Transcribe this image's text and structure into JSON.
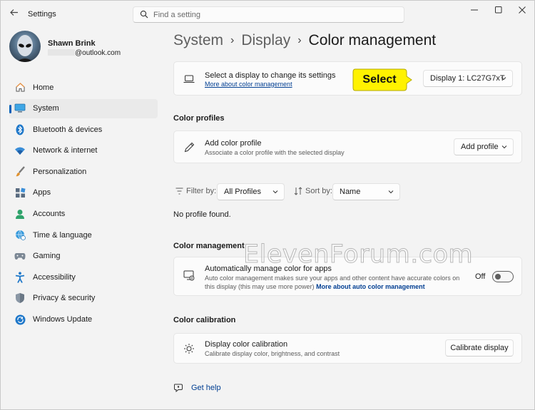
{
  "window": {
    "app_title": "Settings",
    "back_icon": "back-arrow-icon",
    "controls": [
      "minimize-icon",
      "maximize-icon",
      "close-icon"
    ]
  },
  "search": {
    "placeholder": "Find a setting"
  },
  "profile": {
    "name": "Shawn Brink",
    "email_suffix": "@outlook.com"
  },
  "sidebar": {
    "items": [
      {
        "label": "Home",
        "icon": "home-icon",
        "active": false
      },
      {
        "label": "System",
        "icon": "system-icon",
        "active": true
      },
      {
        "label": "Bluetooth & devices",
        "icon": "bluetooth-icon",
        "active": false
      },
      {
        "label": "Network & internet",
        "icon": "wifi-icon",
        "active": false
      },
      {
        "label": "Personalization",
        "icon": "brush-icon",
        "active": false
      },
      {
        "label": "Apps",
        "icon": "apps-icon",
        "active": false
      },
      {
        "label": "Accounts",
        "icon": "account-icon",
        "active": false
      },
      {
        "label": "Time & language",
        "icon": "globe-clock-icon",
        "active": false
      },
      {
        "label": "Gaming",
        "icon": "gamepad-icon",
        "active": false
      },
      {
        "label": "Accessibility",
        "icon": "accessibility-icon",
        "active": false
      },
      {
        "label": "Privacy & security",
        "icon": "shield-icon",
        "active": false
      },
      {
        "label": "Windows Update",
        "icon": "update-icon",
        "active": false
      }
    ]
  },
  "breadcrumb": {
    "level1": "System",
    "level2": "Display",
    "current": "Color management",
    "separator": "›"
  },
  "display_card": {
    "title": "Select a display to change its settings",
    "link": "More about color management",
    "dropdown_value": "Display 1: LC27G7xT",
    "callout": "Select"
  },
  "color_profiles": {
    "heading": "Color profiles",
    "add_title": "Add color profile",
    "add_sub": "Associate a color profile with the selected display",
    "add_button": "Add profile",
    "filter_label": "Filter by:",
    "filter_value": "All Profiles",
    "sort_label": "Sort by:",
    "sort_value": "Name",
    "empty_text": "No profile found."
  },
  "color_management": {
    "heading": "Color management",
    "auto_title": "Automatically manage color for apps",
    "auto_sub_1": "Auto color management makes sure your apps and other content have accurate colors on",
    "auto_sub_2": "this display (this may use more power)",
    "auto_link": "More about auto color management",
    "toggle_state": "Off"
  },
  "color_calibration": {
    "heading": "Color calibration",
    "title": "Display color calibration",
    "sub": "Calibrate display color, brightness, and contrast",
    "button": "Calibrate display"
  },
  "help": {
    "label": "Get help"
  },
  "watermark": "ElevenForum.com",
  "colors": {
    "accent": "#005fb8",
    "link": "#003e92",
    "callout": "#fff200"
  }
}
